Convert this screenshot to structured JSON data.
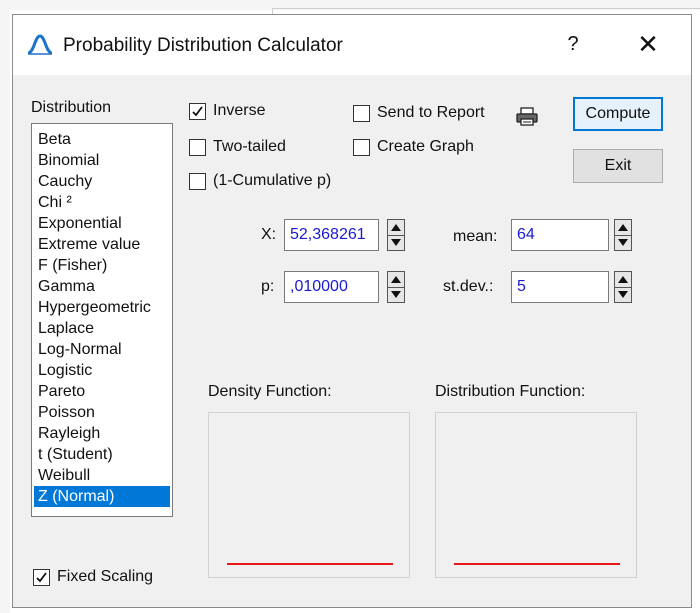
{
  "window": {
    "title": "Probability Distribution Calculator",
    "help_label": "?",
    "close_label": "✕",
    "app_icon": "bell-curve-icon"
  },
  "distribution": {
    "label": "Distribution",
    "items": [
      "Beta",
      "Binomial",
      "Cauchy",
      "Chi ²",
      "Exponential",
      "Extreme value",
      "F (Fisher)",
      "Gamma",
      "Hypergeometric",
      "Laplace",
      "Log-Normal",
      "Logistic",
      "Pareto",
      "Poisson",
      "Rayleigh",
      "t (Student)",
      "Weibull",
      "Z (Normal)"
    ],
    "selected": "Z (Normal)"
  },
  "options": {
    "inverse": {
      "label": "Inverse",
      "checked": true
    },
    "two_tailed": {
      "label": "Two-tailed",
      "checked": false
    },
    "one_minus_cumulative": {
      "label": "(1-Cumulative p)",
      "checked": false
    },
    "send_to_report": {
      "label": "Send to Report",
      "checked": false
    },
    "create_graph": {
      "label": "Create Graph",
      "checked": false
    },
    "fixed_scaling": {
      "label": "Fixed Scaling",
      "checked": true
    }
  },
  "buttons": {
    "compute": "Compute",
    "exit": "Exit"
  },
  "params": {
    "x_label": "X:",
    "x_value": "52,368261",
    "p_label": "p:",
    "p_value": ",010000",
    "mean_label": "mean:",
    "mean_value": "64",
    "stdev_label": "st.dev.:",
    "stdev_value": "5"
  },
  "plots": {
    "density_label": "Density Function:",
    "distribution_label": "Distribution Function:"
  },
  "colors": {
    "selection": "#0078d7",
    "field_text": "#1a1ad0",
    "plot_line": "#e8171a"
  }
}
